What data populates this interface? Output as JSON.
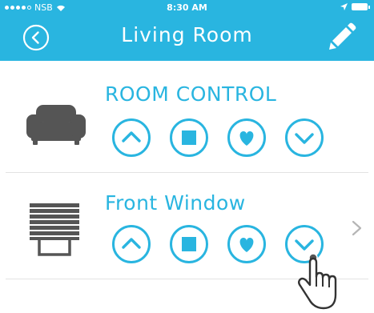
{
  "colors": {
    "accent": "#29b5e0",
    "header_bg": "#29b5e0",
    "icon_gray": "#555555",
    "divider": "#e3e3e3",
    "chevron": "#b5b5b5"
  },
  "status_bar": {
    "carrier": "NSB",
    "time": "8:30 AM"
  },
  "header": {
    "title": "Living Room",
    "back_icon": "chevron-left-circle-icon",
    "edit_icon": "pencil-icon"
  },
  "rows": [
    {
      "label": "ROOM CONTROL",
      "icon": "armchair-icon",
      "controls": [
        "up-icon",
        "stop-icon",
        "favorite-heart-icon",
        "down-icon"
      ],
      "has_chevron": false
    },
    {
      "label": "Front Window",
      "icon": "blinds-icon",
      "controls": [
        "up-icon",
        "stop-icon",
        "favorite-heart-icon",
        "down-icon"
      ],
      "has_chevron": true
    }
  ]
}
